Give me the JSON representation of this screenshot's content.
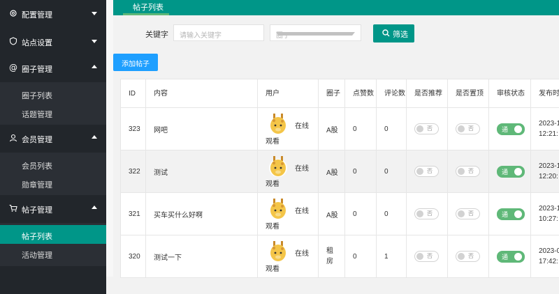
{
  "sidebar": {
    "groups": [
      {
        "label": "配置管理",
        "icon": "gear-icon",
        "expanded": false
      },
      {
        "label": "站点设置",
        "icon": "shield-icon",
        "expanded": false
      },
      {
        "label": "圈子管理",
        "icon": "at-icon",
        "expanded": true,
        "items": [
          "圈子列表",
          "话题管理"
        ]
      },
      {
        "label": "会员管理",
        "icon": "user-icon",
        "expanded": true,
        "items": [
          "会员列表",
          "勋章管理"
        ]
      },
      {
        "label": "帖子管理",
        "icon": "cart-icon",
        "expanded": true,
        "items": [
          "帖子列表",
          "活动管理"
        ],
        "active_item": "帖子列表"
      }
    ]
  },
  "topbar": {
    "tab": "帖子列表"
  },
  "filter": {
    "keyword_label": "关键字",
    "keyword_placeholder": "请输入关键字",
    "circle_placeholder": "圈子",
    "search_button": "筛选"
  },
  "add_button": "添加帖子",
  "table": {
    "headers": [
      "ID",
      "内容",
      "用户",
      "圈子",
      "点赞数",
      "评论数",
      "是否推荐",
      "是否置顶",
      "审核状态",
      "发布时间"
    ],
    "rows": [
      {
        "id": "323",
        "content": "网吧",
        "user_online": "在线",
        "user_watch": "观看",
        "circle": "A股",
        "likes": "0",
        "comments": "0",
        "recommend": "否",
        "top": "否",
        "review": "通",
        "time": [
          "2023-1",
          "12:21:"
        ]
      },
      {
        "id": "322",
        "content": "测试",
        "user_online": "在线",
        "user_watch": "观看",
        "circle": "A股",
        "likes": "0",
        "comments": "0",
        "recommend": "否",
        "top": "否",
        "review": "通",
        "time": [
          "2023-1",
          "12:20:"
        ]
      },
      {
        "id": "321",
        "content": "买车买什么好啊",
        "user_online": "在线",
        "user_watch": "观看",
        "circle": "A股",
        "likes": "0",
        "comments": "0",
        "recommend": "否",
        "top": "否",
        "review": "通",
        "time": [
          "2023-1",
          "10:27:"
        ]
      },
      {
        "id": "320",
        "content": "测试一下",
        "user_online": "在线",
        "user_watch": "观看",
        "circle": "租房",
        "likes": "0",
        "comments": "1",
        "recommend": "否",
        "top": "否",
        "review": "通",
        "time": [
          "2023-0",
          "17:42:"
        ]
      }
    ]
  },
  "colors": {
    "primary": "#009688",
    "blue": "#1e9fff",
    "switch_on": "#5fb878",
    "sidebar_bg": "#2b2f35"
  }
}
